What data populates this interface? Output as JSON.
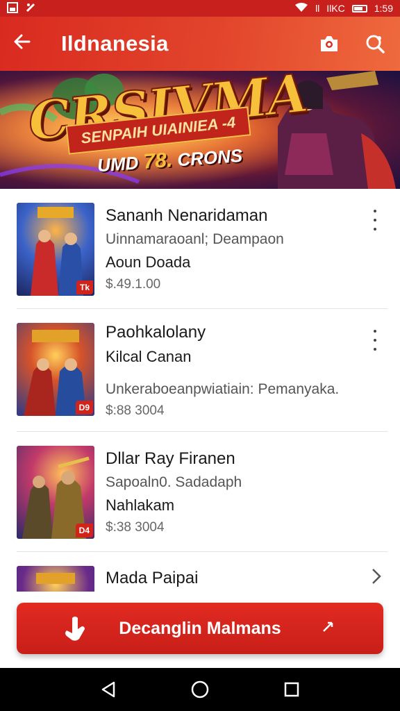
{
  "status_bar": {
    "signal_text": "ll",
    "network_text": "IlKC",
    "time": "1:59"
  },
  "app_bar": {
    "title": "Ildnanesia"
  },
  "banner": {
    "title": "CRSIVMA",
    "ribbon": "SENPAIH UIAINIEA -4",
    "tag_prefix": "UMD",
    "tag_number": "78.",
    "tag_suffix": "CRONS"
  },
  "list": {
    "items": [
      {
        "name": "Sananh Nenaridaman",
        "line2": "Uinnamaraoanl; Deampaon",
        "line3": "Aoun Doada",
        "price": "$.49.1.00",
        "badge": "Tk",
        "action": "more"
      },
      {
        "name": "Paohkalolany",
        "line2": "Kilcal Canan",
        "line3": "Unkeraboeanpwiatiain: Pemanyaka.",
        "price": "$:88 3004",
        "badge": "D9",
        "action": "more"
      },
      {
        "name": "Dllar Ray Firanen",
        "line2": "Sapoaln0. Sadadaph",
        "line3": "Nahlakam",
        "price": "$:38 3004",
        "badge": "D4",
        "action": "none"
      },
      {
        "name": "Mada Paipai",
        "line2": "",
        "line3": "",
        "price": "",
        "badge": "",
        "action": "chevron"
      }
    ]
  },
  "cta": {
    "label": "Decanglin Malmans"
  },
  "colors": {
    "brand_red": "#d92a20"
  }
}
